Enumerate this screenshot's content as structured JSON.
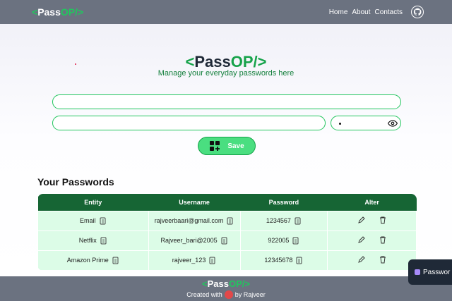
{
  "navbar": {
    "logo": {
      "open": "< ",
      "pass": "Pass",
      "op": "OP/",
      "close": ">"
    },
    "links": [
      "Home",
      "About",
      "Contacts"
    ],
    "github_icon": "github-icon"
  },
  "hero": {
    "title": {
      "open": "<",
      "pass": "Pass",
      "op": "OP/",
      "close": ">"
    },
    "subtitle": "Manage your everyday passwords here"
  },
  "form": {
    "url_value": "",
    "username_value": "",
    "password_icon": "eye-icon",
    "save_label": "Save",
    "save_icon": "add-grid-icon"
  },
  "passwords": {
    "heading": "Your Passwords",
    "columns": [
      "Entity",
      "Username",
      "Password",
      "Alter"
    ],
    "rows": [
      {
        "entity": "Email",
        "username": "rajveerbaari@gmail.com",
        "password": "1234567"
      },
      {
        "entity": "Netflix",
        "username": "Rajveer_bari@2005",
        "password": "922005"
      },
      {
        "entity": "Amazon Prime",
        "username": "rajveer_123",
        "password": "12345678"
      }
    ]
  },
  "footer": {
    "logo": {
      "open": "< ",
      "pass": "Pass",
      "op": "OP/",
      "close": ">"
    },
    "created_with": "Created with",
    "by": "by Rajveer"
  },
  "toast": {
    "text": "Passwor"
  },
  "colors": {
    "nav": "#6b7280",
    "accent": "#22c55e",
    "table_header": "#166534",
    "table_cell": "#dcfce7"
  }
}
